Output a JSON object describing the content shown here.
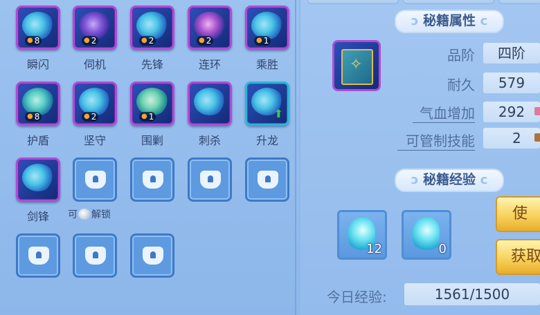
{
  "skills": [
    {
      "label": "瞬闪",
      "count": "8"
    },
    {
      "label": "伺机",
      "count": "2"
    },
    {
      "label": "先锋",
      "count": "2"
    },
    {
      "label": "连环",
      "count": "2"
    },
    {
      "label": "乘胜",
      "count": "1"
    },
    {
      "label": "护盾",
      "count": "8"
    },
    {
      "label": "坚守",
      "count": "2"
    },
    {
      "label": "围剿",
      "count": "1"
    },
    {
      "label": "刺杀",
      "count": ""
    },
    {
      "label": "升龙",
      "count": ""
    },
    {
      "label": "剑锋",
      "count": ""
    }
  ],
  "unlock_hint": {
    "prefix": "可",
    "suffix": "解锁"
  },
  "attributes_title": "秘籍属性",
  "attributes": {
    "grade_label": "品阶",
    "grade_value": "四阶",
    "durability_label": "耐久",
    "durability_value": "579",
    "hp_label": "气血增加",
    "hp_value": "292",
    "skill_ctrl_label": "可管制技能",
    "skill_ctrl_value": "2"
  },
  "exp_title": "秘籍经验",
  "exp_items": [
    {
      "count": "12"
    },
    {
      "count": "0"
    }
  ],
  "buttons": {
    "use": "使",
    "obtain": "获取"
  },
  "today_exp_label": "今日经验:",
  "today_exp_value": "1561/1500",
  "colors": {
    "accent_purple": "#b04bd6",
    "accent_cyan": "#28b6d8",
    "panel_blue": "#8fb8ea"
  }
}
